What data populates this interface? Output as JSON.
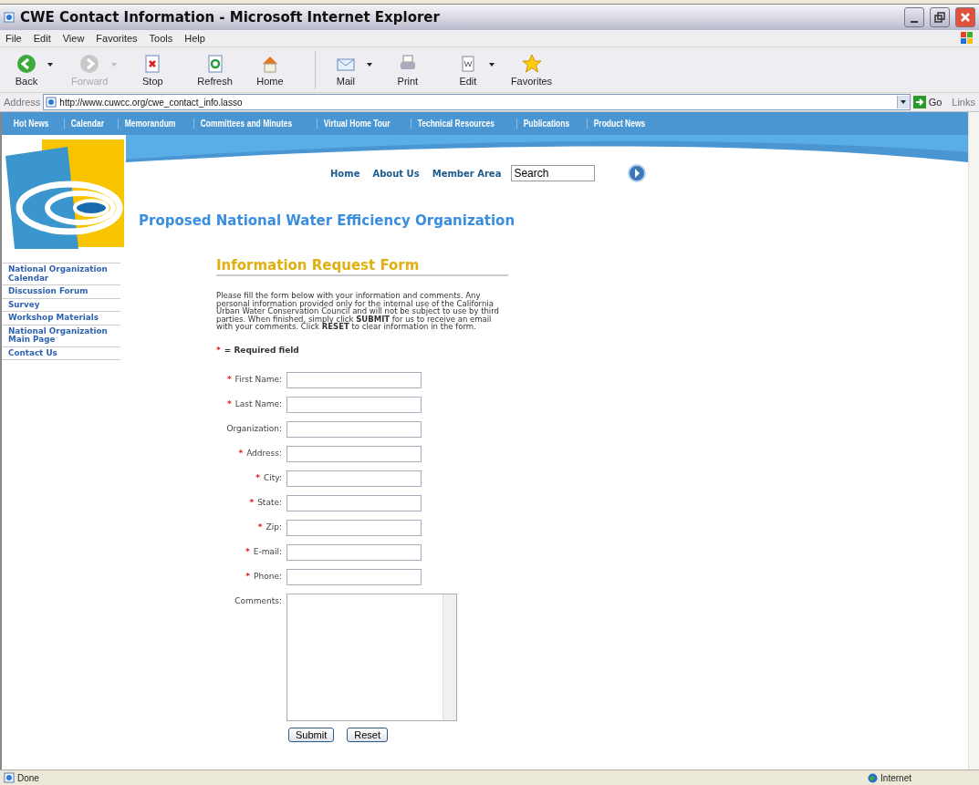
{
  "window": {
    "title": "CWE Contact Information - Microsoft Internet Explorer"
  },
  "menu": [
    "File",
    "Edit",
    "View",
    "Favorites",
    "Tools",
    "Help"
  ],
  "toolbar": [
    {
      "label": "Back",
      "disabled": false,
      "dropdown": true
    },
    {
      "label": "Forward",
      "disabled": true,
      "dropdown": true
    },
    {
      "label": "Stop",
      "disabled": false,
      "dropdown": false
    },
    {
      "label": "Refresh",
      "disabled": false,
      "dropdown": false
    },
    {
      "label": "Home",
      "disabled": false,
      "dropdown": false
    },
    {
      "label": "Mail",
      "disabled": false,
      "dropdown": true
    },
    {
      "label": "Print",
      "disabled": false,
      "dropdown": false
    },
    {
      "label": "Edit",
      "disabled": false,
      "dropdown": true
    },
    {
      "label": "Favorites",
      "disabled": false,
      "dropdown": false
    }
  ],
  "address_bar": {
    "label": "Address",
    "url": "http://www.cuwcc.org/cwe_contact_info.lasso",
    "go": "Go",
    "links": "Links"
  },
  "site_nav": [
    "Hot News",
    "Calendar",
    "Memorandum",
    "Committees and Minutes",
    "Virtual Home Tour",
    "Technical Resources",
    "Publications",
    "Product News"
  ],
  "header_links": [
    "Home",
    "About Us",
    "Member Area"
  ],
  "search": {
    "value": "Search"
  },
  "site_title": "Proposed National Water Efficiency Organization",
  "sidebar": {
    "items": [
      "National Organization Calendar",
      "Discussion Forum",
      "Survey",
      "Workshop Materials",
      "National Organization Main Page",
      "Contact Us"
    ]
  },
  "form": {
    "title": "Information Request Form",
    "intro": "Please fill the form below with your information and comments. Any personal information provided only for the internal use of the California Urban Water Conservation Council and will not be subject to use by third parties. When finished, simply click **SUBMIT** for us to receive an email with your comments. Click **RESET** to clear information in the form.",
    "required_mark": "*",
    "required_note": "= Required field",
    "fields": [
      {
        "label": "First Name:",
        "required": true,
        "kind": "input"
      },
      {
        "label": "Last Name:",
        "required": true,
        "kind": "input"
      },
      {
        "label": "Organization:",
        "required": false,
        "kind": "input"
      },
      {
        "label": "Address:",
        "required": true,
        "kind": "input"
      },
      {
        "label": "City:",
        "required": true,
        "kind": "input"
      },
      {
        "label": "State:",
        "required": true,
        "kind": "input"
      },
      {
        "label": "Zip:",
        "required": true,
        "kind": "input"
      },
      {
        "label": "E-mail:",
        "required": true,
        "kind": "input"
      },
      {
        "label": "Phone:",
        "required": true,
        "kind": "input"
      },
      {
        "label": "Comments:",
        "required": false,
        "kind": "textarea"
      }
    ],
    "buttons": [
      "Submit",
      "Reset"
    ]
  },
  "status_bar": {
    "text": "Done",
    "zone": "Internet"
  }
}
